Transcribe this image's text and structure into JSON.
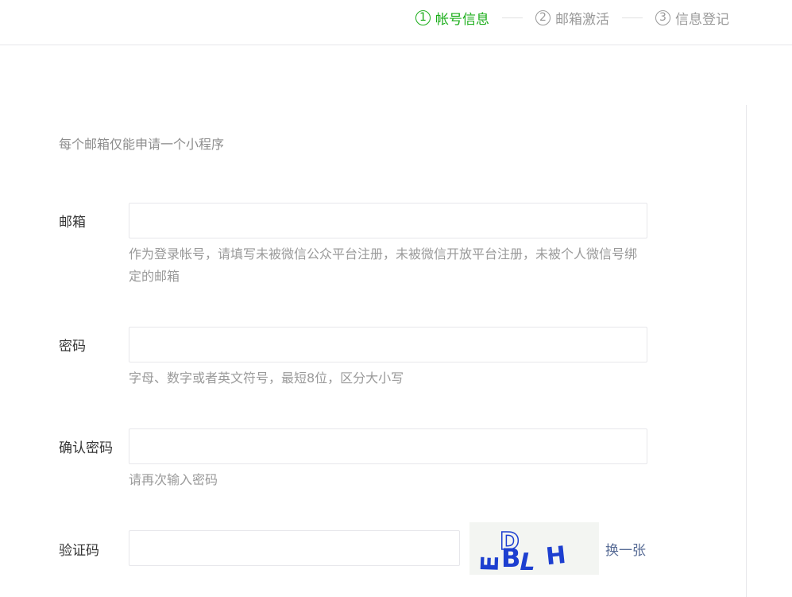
{
  "steps": [
    {
      "num": "1",
      "label": "帐号信息",
      "active": true
    },
    {
      "num": "2",
      "label": "邮箱激活",
      "active": false
    },
    {
      "num": "3",
      "label": "信息登记",
      "active": false
    }
  ],
  "form": {
    "intro": "每个邮箱仅能申请一个小程序",
    "email": {
      "label": "邮箱",
      "value": "",
      "hint": "作为登录帐号，请填写未被微信公众平台注册，未被微信开放平台注册，未被个人微信号绑定的邮箱"
    },
    "password": {
      "label": "密码",
      "value": "",
      "hint": "字母、数字或者英文符号，最短8位，区分大小写"
    },
    "confirm": {
      "label": "确认密码",
      "value": "",
      "hint": "请再次输入密码"
    },
    "captcha": {
      "label": "验证码",
      "value": "",
      "image_text": "EDLH",
      "refresh": "换一张"
    }
  },
  "colors": {
    "active_step": "#1aad19",
    "link": "#576b95",
    "captcha_glyphs": "#1d3fd0"
  }
}
